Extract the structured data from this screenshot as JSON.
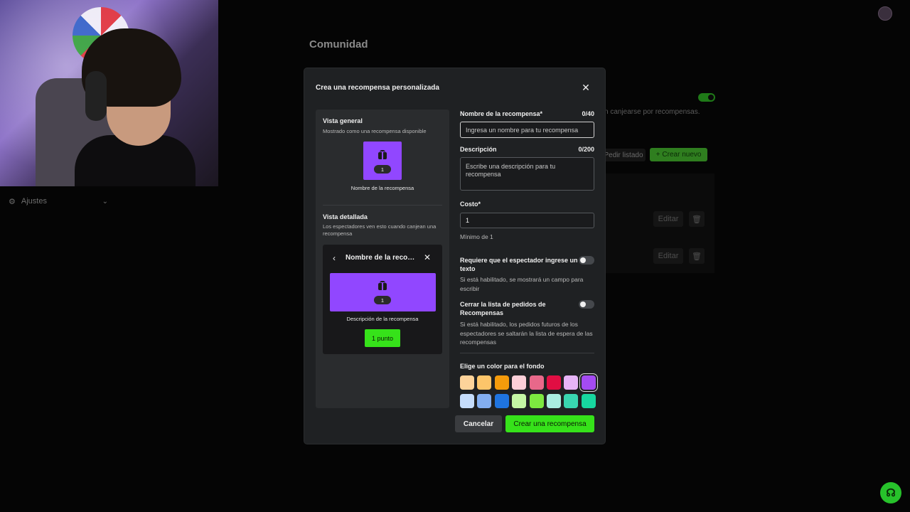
{
  "background": {
    "title": "Comunidad",
    "sidebar_settings_label": "Ajustes",
    "description_fragment": "n canjearse por recompensas.",
    "pedir_listado_label": "Pedir listado",
    "crear_nuevo_label": "Crear nuevo",
    "edit_label": "Editar"
  },
  "modal": {
    "title": "Crea una recompensa personalizada",
    "preview": {
      "general_title": "Vista general",
      "general_subtitle": "Mostrado como una recompensa disponible",
      "tile_count": "1",
      "tile_name": "Nombre de la recompensa",
      "detail_title": "Vista detallada",
      "detail_subtitle": "Los espectadores ven esto cuando canjean una recompensa",
      "card_title": "Nombre de la recompensa",
      "card_count": "1",
      "card_description": "Descripción de la recompensa",
      "card_button": "1 punto"
    },
    "form": {
      "name_label": "Nombre de la recompensa*",
      "name_counter": "0/40",
      "name_placeholder": "Ingresa un nombre para tu recompensa",
      "desc_label": "Descripción",
      "desc_counter": "0/200",
      "desc_placeholder": "Escribe una descripción para tu recompensa",
      "cost_label": "Costo*",
      "cost_value": "1",
      "cost_hint": "Mínimo de 1",
      "toggle1_label": "Requiere que el espectador ingrese un texto",
      "toggle1_help": "Si está habilitado, se mostrará un campo para escribir",
      "toggle2_label": "Cerrar la lista de pedidos de Recompensas",
      "toggle2_help": "Si está habilitado, los pedidos futuros de los espectadores se saltarán la lista de espera de las recompensas",
      "color_label": "Elige un color para el fondo",
      "colors": [
        "#fdd39a",
        "#fcc56a",
        "#f59b0b",
        "#fccfd8",
        "#e8688a",
        "#e10e43",
        "#e6b4f7",
        "#a44bf2",
        "#c5dcfb",
        "#83aef0",
        "#1f74e0",
        "#c5f7a5",
        "#7de840",
        "#a9ede0",
        "#39d6b0",
        "#17d79f"
      ],
      "selected_color": "#a44bf2"
    },
    "buttons": {
      "cancel": "Cancelar",
      "create": "Crear una recompensa"
    }
  },
  "icons": {
    "close": "✕",
    "back": "‹",
    "gear": "⚙",
    "chevron": "⌄",
    "plus": "+",
    "trash": "🗑"
  },
  "accent_colors": {
    "green": "#36e21a",
    "purple": "#9147ff"
  }
}
